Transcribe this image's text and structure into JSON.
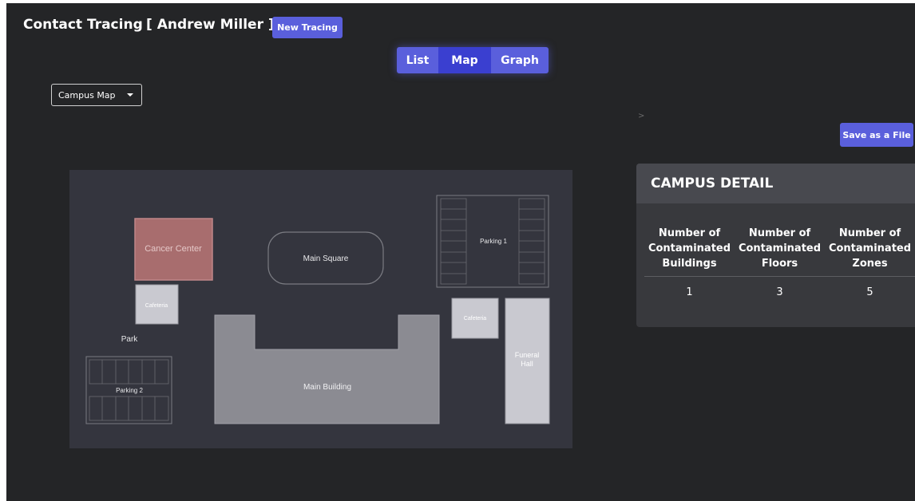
{
  "header": {
    "title": "Contact Tracing",
    "user": "[ Andrew Miller ]",
    "new_tracing_label": "New Tracing"
  },
  "view_tabs": [
    {
      "label": "List",
      "active": false
    },
    {
      "label": "Map",
      "active": true
    },
    {
      "label": "Graph",
      "active": false
    }
  ],
  "map_select": {
    "value": "Campus Map"
  },
  "collapse_hint": ">",
  "save_label": "Save as a File",
  "map": {
    "labels": {
      "cancer_center": "Cancer Center",
      "main_square": "Main Square",
      "parking1": "Parking 1",
      "cafeteria_left": "Cafeteria",
      "cafeteria_right": "Cafeteria",
      "park": "Park",
      "parking2": "Parking 2",
      "main_building": "Main Building",
      "funeral_hall_line1": "Funeral",
      "funeral_hall_line2": "Hall"
    },
    "colors": {
      "background": "#34353e",
      "contaminated": "#a86d6e",
      "light_building": "#c9c9d0",
      "main_building": "#8b8b92"
    }
  },
  "campus_detail": {
    "title": "CAMPUS DETAIL",
    "headers": [
      [
        "Number of",
        "Contaminated",
        "Buildings"
      ],
      [
        "Number of",
        "Contaminated",
        "Floors"
      ],
      [
        "Number of",
        "Contaminated",
        "Zones"
      ]
    ],
    "values": [
      "1",
      "3",
      "5"
    ]
  },
  "colors": {
    "accent": "#5a5fdc",
    "background": "#242527",
    "panel": "#38393d"
  }
}
